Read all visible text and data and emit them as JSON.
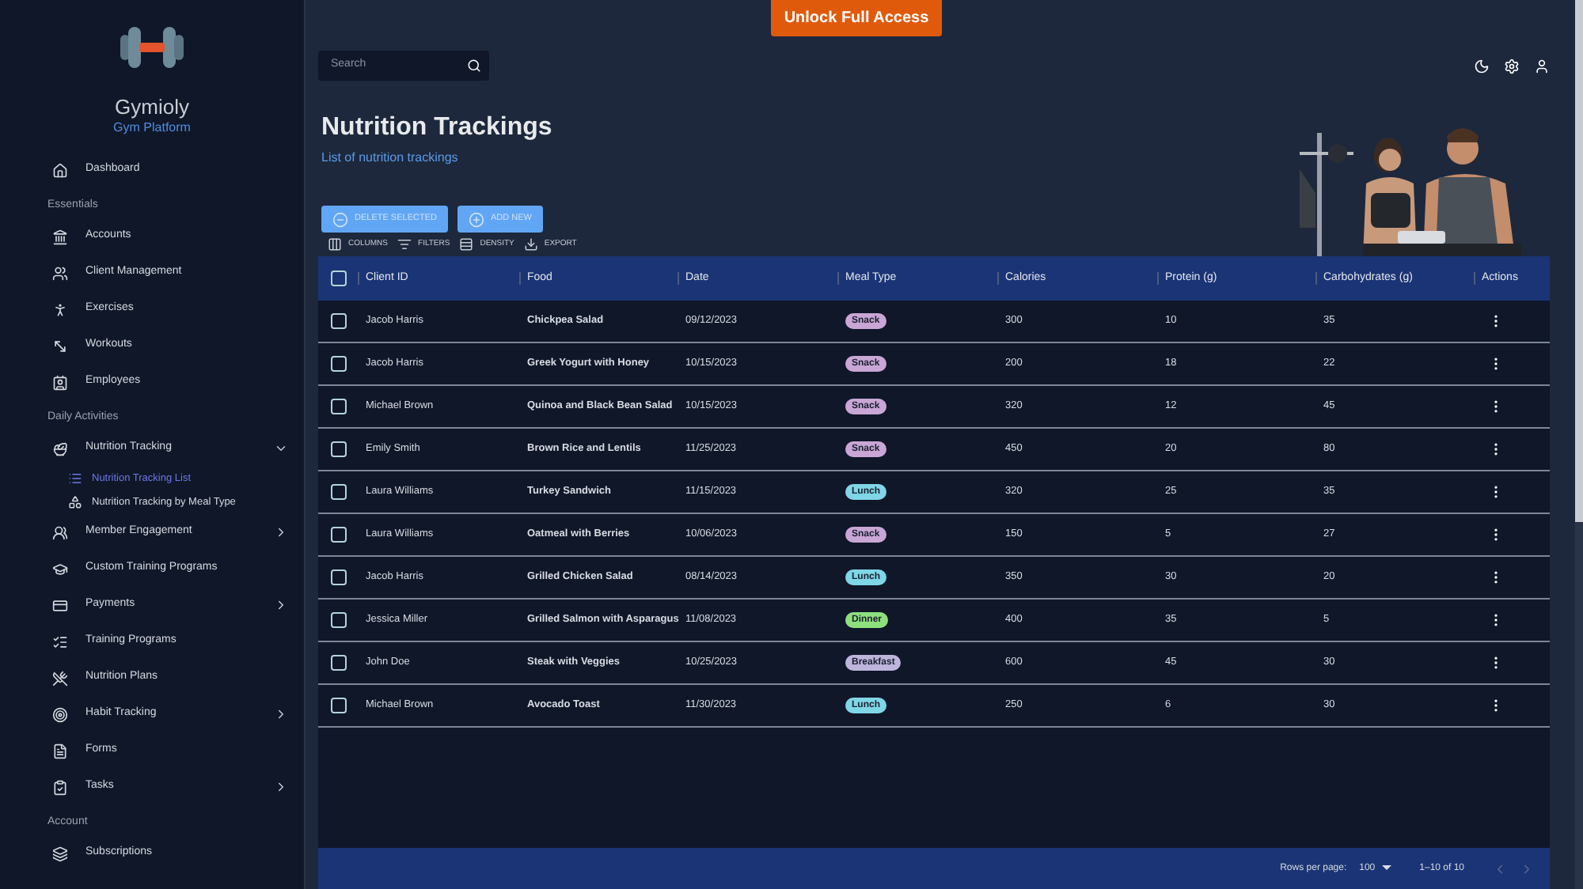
{
  "brand": {
    "name": "Gymioly",
    "tagline": "Gym Platform"
  },
  "sidebar": [
    {
      "kind": "item",
      "label": "Dashboard"
    },
    {
      "kind": "heading",
      "label": "Essentials"
    },
    {
      "kind": "item",
      "label": "Accounts"
    },
    {
      "kind": "item",
      "label": "Client Management"
    },
    {
      "kind": "item",
      "label": "Exercises"
    },
    {
      "kind": "item",
      "label": "Workouts"
    },
    {
      "kind": "item",
      "label": "Employees"
    },
    {
      "kind": "heading",
      "label": "Daily Activities"
    },
    {
      "kind": "group",
      "label": "Nutrition Tracking",
      "expanded": true,
      "children": [
        {
          "label": "Nutrition Tracking List",
          "selected": true
        },
        {
          "label": "Nutrition Tracking by Meal Type",
          "selected": false
        }
      ]
    },
    {
      "kind": "group",
      "label": "Member Engagement",
      "expanded": false
    },
    {
      "kind": "item",
      "label": "Custom Training Programs"
    },
    {
      "kind": "group",
      "label": "Payments",
      "expanded": false
    },
    {
      "kind": "item",
      "label": "Training Programs"
    },
    {
      "kind": "item",
      "label": "Nutrition Plans"
    },
    {
      "kind": "group",
      "label": "Habit Tracking",
      "expanded": false
    },
    {
      "kind": "item",
      "label": "Forms"
    },
    {
      "kind": "group",
      "label": "Tasks",
      "expanded": false
    },
    {
      "kind": "heading",
      "label": "Account"
    },
    {
      "kind": "item",
      "label": "Subscriptions"
    }
  ],
  "unlock_button": "Unlock Full Access",
  "search": {
    "placeholder": "Search"
  },
  "page": {
    "title": "Nutrition Trackings",
    "subtitle": "List of nutrition trackings"
  },
  "actions": [
    {
      "kind": "delete",
      "label": "DELETE SELECTED"
    },
    {
      "kind": "add",
      "label": "ADD NEW"
    }
  ],
  "toolbar": [
    {
      "kind": "columns",
      "label": "COLUMNS"
    },
    {
      "kind": "filters",
      "label": "FILTERS"
    },
    {
      "kind": "density",
      "label": "DENSITY"
    },
    {
      "kind": "export",
      "label": "EXPORT"
    }
  ],
  "table": {
    "all_checked": false,
    "columns": [
      "Client ID",
      "Food",
      "Date",
      "Meal Type",
      "Calories",
      "Protein (g)",
      "Carbohydrates (g)",
      "Actions"
    ],
    "rows": [
      {
        "checked": false,
        "client": "Jacob Harris",
        "food": "Chickpea Salad",
        "date": "09/12/2023",
        "meal": {
          "label": "Snack",
          "color": "#c9a6d6"
        },
        "calories": "300",
        "protein": "10",
        "carbs": "35"
      },
      {
        "checked": false,
        "client": "Jacob Harris",
        "food": "Greek Yogurt with Honey",
        "date": "10/15/2023",
        "meal": {
          "label": "Snack",
          "color": "#c9a6d6"
        },
        "calories": "200",
        "protein": "18",
        "carbs": "22"
      },
      {
        "checked": false,
        "client": "Michael Brown",
        "food": "Quinoa and Black Bean Salad",
        "date": "10/15/2023",
        "meal": {
          "label": "Snack",
          "color": "#c9a6d6"
        },
        "calories": "320",
        "protein": "12",
        "carbs": "45"
      },
      {
        "checked": false,
        "client": "Emily Smith",
        "food": "Brown Rice and Lentils",
        "date": "11/25/2023",
        "meal": {
          "label": "Snack",
          "color": "#c9a6d6"
        },
        "calories": "450",
        "protein": "20",
        "carbs": "80"
      },
      {
        "checked": false,
        "client": "Laura Williams",
        "food": "Turkey Sandwich",
        "date": "11/15/2023",
        "meal": {
          "label": "Lunch",
          "color": "#7fd6e6"
        },
        "calories": "320",
        "protein": "25",
        "carbs": "35"
      },
      {
        "checked": false,
        "client": "Laura Williams",
        "food": "Oatmeal with Berries",
        "date": "10/06/2023",
        "meal": {
          "label": "Snack",
          "color": "#c9a6d6"
        },
        "calories": "150",
        "protein": "5",
        "carbs": "27"
      },
      {
        "checked": false,
        "client": "Jacob Harris",
        "food": "Grilled Chicken Salad",
        "date": "08/14/2023",
        "meal": {
          "label": "Lunch",
          "color": "#7fd6e6"
        },
        "calories": "350",
        "protein": "30",
        "carbs": "20"
      },
      {
        "checked": false,
        "client": "Jessica Miller",
        "food": "Grilled Salmon with Asparagus",
        "date": "11/08/2023",
        "meal": {
          "label": "Dinner",
          "color": "#8ee07e"
        },
        "calories": "400",
        "protein": "35",
        "carbs": "5"
      },
      {
        "checked": false,
        "client": "John Doe",
        "food": "Steak with Veggies",
        "date": "10/25/2023",
        "meal": {
          "label": "Breakfast",
          "color": "#bdb5dc"
        },
        "calories": "600",
        "protein": "45",
        "carbs": "30"
      },
      {
        "checked": false,
        "client": "Michael Brown",
        "food": "Avocado Toast",
        "date": "11/30/2023",
        "meal": {
          "label": "Lunch",
          "color": "#7fd6e6"
        },
        "calories": "250",
        "protein": "6",
        "carbs": "30"
      }
    ]
  },
  "footer": {
    "rows_per_page_label": "Rows per page:",
    "rows_per_page": "100",
    "range": "1–10 of 10",
    "prev_disabled": true,
    "next_disabled": true
  }
}
